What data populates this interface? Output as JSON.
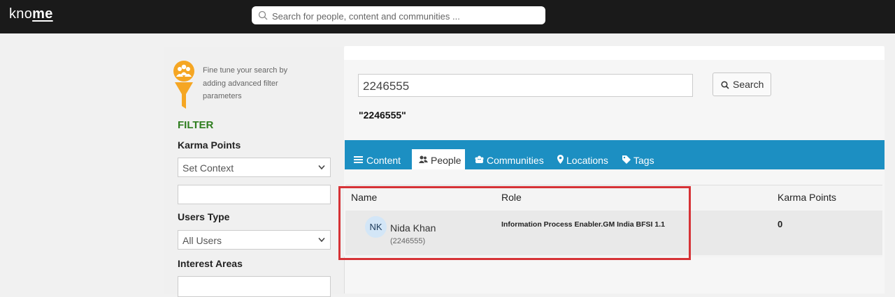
{
  "app": {
    "logo_light": "kno",
    "logo_bold": "me"
  },
  "topbar": {
    "search_placeholder": "Search for people, content and communities ..."
  },
  "sidebar": {
    "hint": "Fine tune your search by adding advanced filter parameters",
    "filter_title": "FILTER",
    "karma_label": "Karma Points",
    "karma_select": "Set Context",
    "users_type_label": "Users Type",
    "users_type_select": "All Users",
    "interest_label": "Interest Areas"
  },
  "main": {
    "query_value": "2246555",
    "search_button": "Search",
    "query_echo": "\"2246555\"",
    "tabs": [
      {
        "label": "Content",
        "icon": "list-icon"
      },
      {
        "label": "People",
        "icon": "people-icon"
      },
      {
        "label": "Communities",
        "icon": "communities-icon"
      },
      {
        "label": "Locations",
        "icon": "location-pin-icon"
      },
      {
        "label": "Tags",
        "icon": "tag-icon"
      }
    ],
    "active_tab": "People",
    "columns": {
      "name": "Name",
      "role": "Role",
      "karma": "Karma Points"
    },
    "results": [
      {
        "initials": "NK",
        "name": "Nida Khan",
        "id": "(2246555)",
        "role": "Information Process Enabler.GM India BFSI 1.1",
        "karma": "0"
      }
    ]
  },
  "colors": {
    "tab_bar": "#1c8fc2",
    "filter_title": "#2e7d1e",
    "highlight": "#d63236",
    "funnel": "#f5a623"
  }
}
